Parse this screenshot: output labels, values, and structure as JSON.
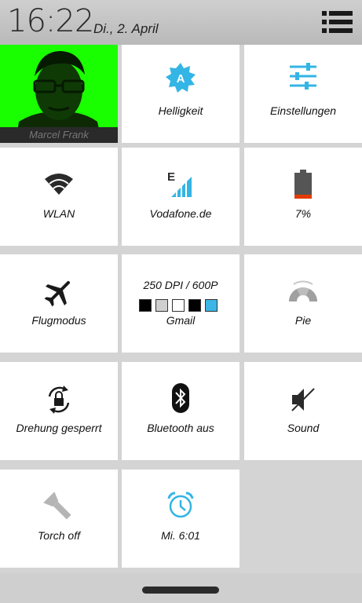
{
  "status": {
    "time": "16:22",
    "date": "Di., 2. April"
  },
  "tiles": {
    "profile": {
      "name": "Marcel Frank"
    },
    "brightness": {
      "label": "Helligkeit",
      "badge": "A"
    },
    "settings": {
      "label": "Einstellungen"
    },
    "wifi": {
      "label": "WLAN"
    },
    "mobile": {
      "label": "Vodafone.de",
      "network_type": "E"
    },
    "battery": {
      "label": "7%"
    },
    "airplane": {
      "label": "Flugmodus"
    },
    "dpi": {
      "title": "250 DPI / 600P",
      "label": "Gmail",
      "swatches": [
        "#000000",
        "#cccccc",
        "#ffffff",
        "#000000",
        "#3cb4e5"
      ]
    },
    "pie": {
      "label": "Pie"
    },
    "rotation": {
      "label": "Drehung gesperrt"
    },
    "bluetooth": {
      "label": "Bluetooth aus"
    },
    "sound": {
      "label": "Sound"
    },
    "torch": {
      "label": "Torch off"
    },
    "alarm": {
      "label": "Mi.  6:01"
    }
  },
  "colors": {
    "accent": "#33b5e5",
    "profile_bg": "#1aff00",
    "battery_low": "#e53b00"
  },
  "icons": [
    "menu-list-icon",
    "brightness-auto-icon",
    "sliders-icon",
    "wifi-icon",
    "signal-icon",
    "battery-icon",
    "airplane-icon",
    "pie-icon",
    "rotation-lock-icon",
    "bluetooth-icon",
    "sound-muted-icon",
    "flashlight-icon",
    "alarm-clock-icon"
  ]
}
